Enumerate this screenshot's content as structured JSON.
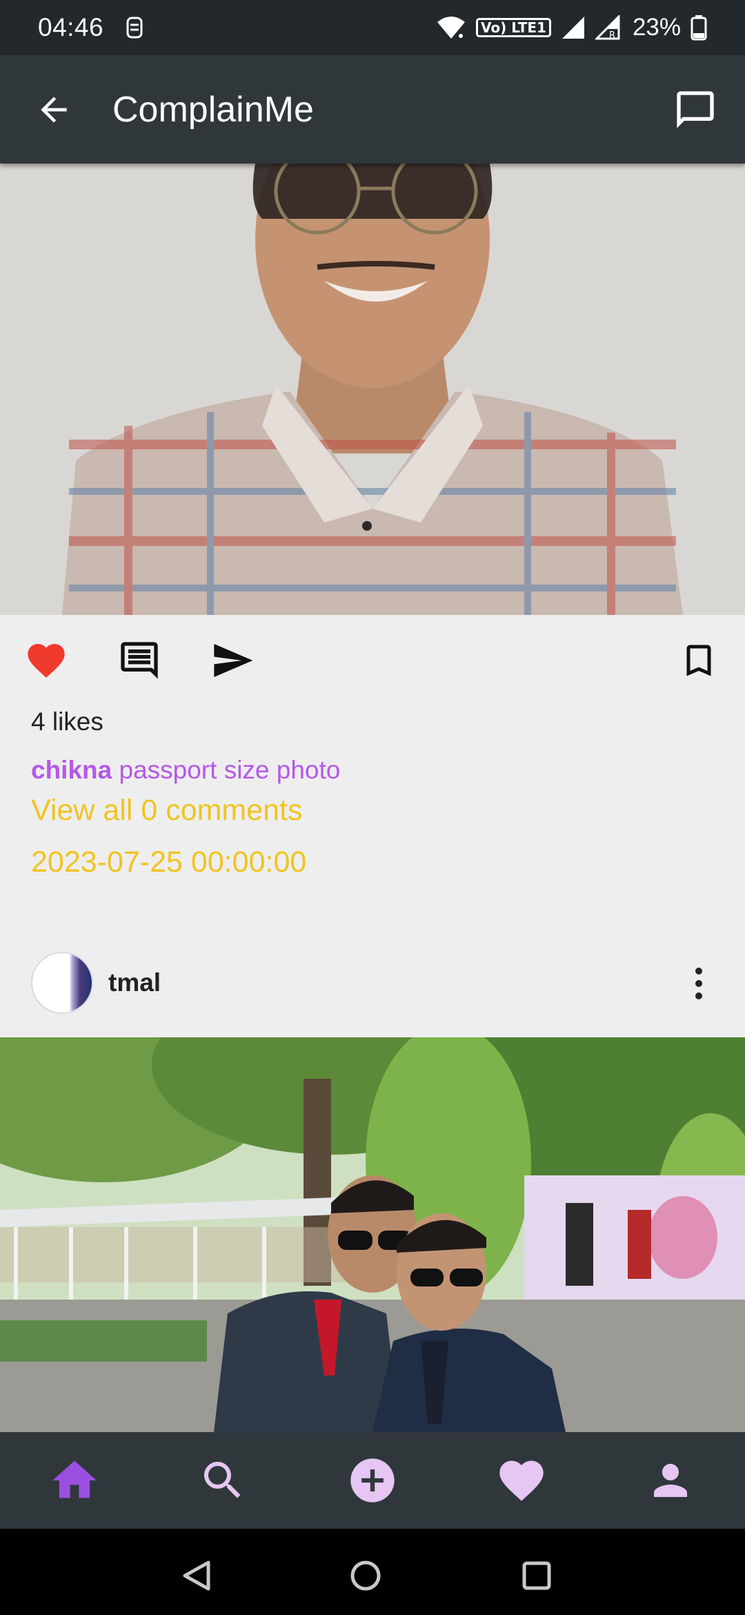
{
  "status_bar": {
    "time": "04:46",
    "lte_label": "Vo) LTE1",
    "battery_percent": "23%"
  },
  "app_bar": {
    "title": "ComplainMe",
    "back_icon": "arrow-back-icon",
    "action_icon": "chat-bubble-icon"
  },
  "post1": {
    "image_subject": "passport size photo",
    "liked": true,
    "likes_text": "4 likes",
    "caption_user": "chikna",
    "caption_text": "passport size photo",
    "view_comments": "View all 0 comments",
    "date": "2023-07-25 00:00:00"
  },
  "post2": {
    "username": "tmal",
    "more_icon": "more-vertical-icon"
  },
  "bottom_nav": {
    "items": [
      "home-icon",
      "search-icon",
      "add-circle-icon",
      "heart-icon",
      "person-icon"
    ],
    "active": "home-icon"
  },
  "colors": {
    "status_bar_bg": "#22282c",
    "app_bar_bg": "#30373b",
    "page_bg": "#eeeeee",
    "like_red": "#f03a2e",
    "caption_purple": "#b558e8",
    "accent_yellow": "#f0c420",
    "nav_active_purple": "#9b4fe0",
    "nav_icon_lavender": "#e6c6f2"
  }
}
